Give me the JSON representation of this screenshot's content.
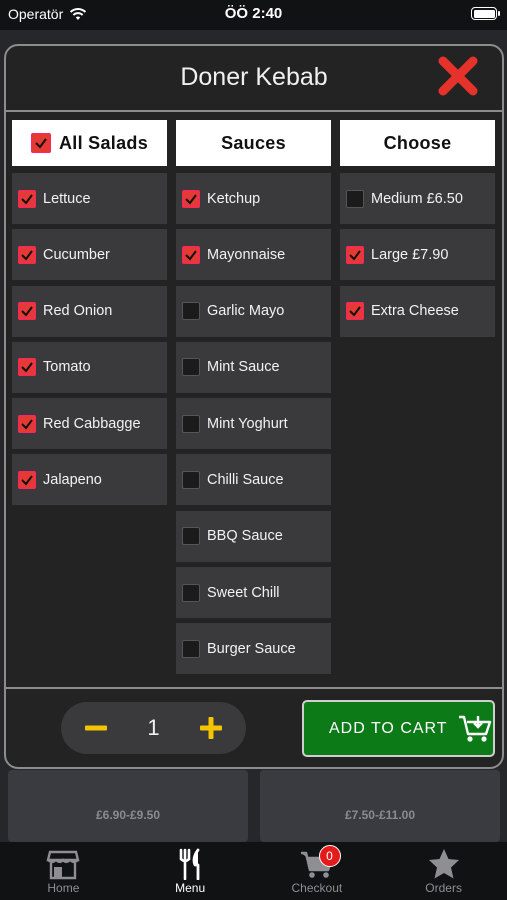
{
  "status_bar": {
    "carrier": "Operatör",
    "time": "ÖÖ 2:40"
  },
  "background": {
    "prices": [
      "£6.90-£9.50",
      "£7.50-£11.00"
    ]
  },
  "modal": {
    "title": "Doner Kebab",
    "columns": [
      {
        "header": "All Salads",
        "header_checked": true,
        "options": [
          {
            "label": "Lettuce",
            "checked": true
          },
          {
            "label": "Cucumber",
            "checked": true
          },
          {
            "label": "Red Onion",
            "checked": true
          },
          {
            "label": "Tomato",
            "checked": true
          },
          {
            "label": "Red Cabbagge",
            "checked": true
          },
          {
            "label": "Jalapeno",
            "checked": true
          }
        ]
      },
      {
        "header": "Sauces",
        "options": [
          {
            "label": "Ketchup",
            "checked": true
          },
          {
            "label": "Mayonnaise",
            "checked": true
          },
          {
            "label": "Garlic Mayo",
            "checked": false
          },
          {
            "label": "Mint Sauce",
            "checked": false
          },
          {
            "label": "Mint Yoghurt",
            "checked": false
          },
          {
            "label": "Chilli Sauce",
            "checked": false
          },
          {
            "label": "BBQ Sauce",
            "checked": false
          },
          {
            "label": "Sweet Chill",
            "checked": false
          },
          {
            "label": "Burger Sauce",
            "checked": false
          }
        ]
      },
      {
        "header": "Choose",
        "options": [
          {
            "label": "Medium £6.50",
            "checked": false
          },
          {
            "label": "Large £7.90",
            "checked": true
          },
          {
            "label": "Extra Cheese",
            "checked": true
          }
        ]
      }
    ],
    "quantity": "1",
    "add_to_cart_label": "ADD TO CART"
  },
  "tab_bar": {
    "tabs": [
      {
        "label": "Home",
        "icon": "store-icon"
      },
      {
        "label": "Menu",
        "icon": "fork-knife-icon",
        "active": true
      },
      {
        "label": "Checkout",
        "icon": "cart-icon",
        "badge": "0"
      },
      {
        "label": "Orders",
        "icon": "star-icon"
      }
    ]
  },
  "colors": {
    "accent_red": "#e53935",
    "cart_green": "#0d7a18",
    "qty_yellow": "#f5c400"
  }
}
